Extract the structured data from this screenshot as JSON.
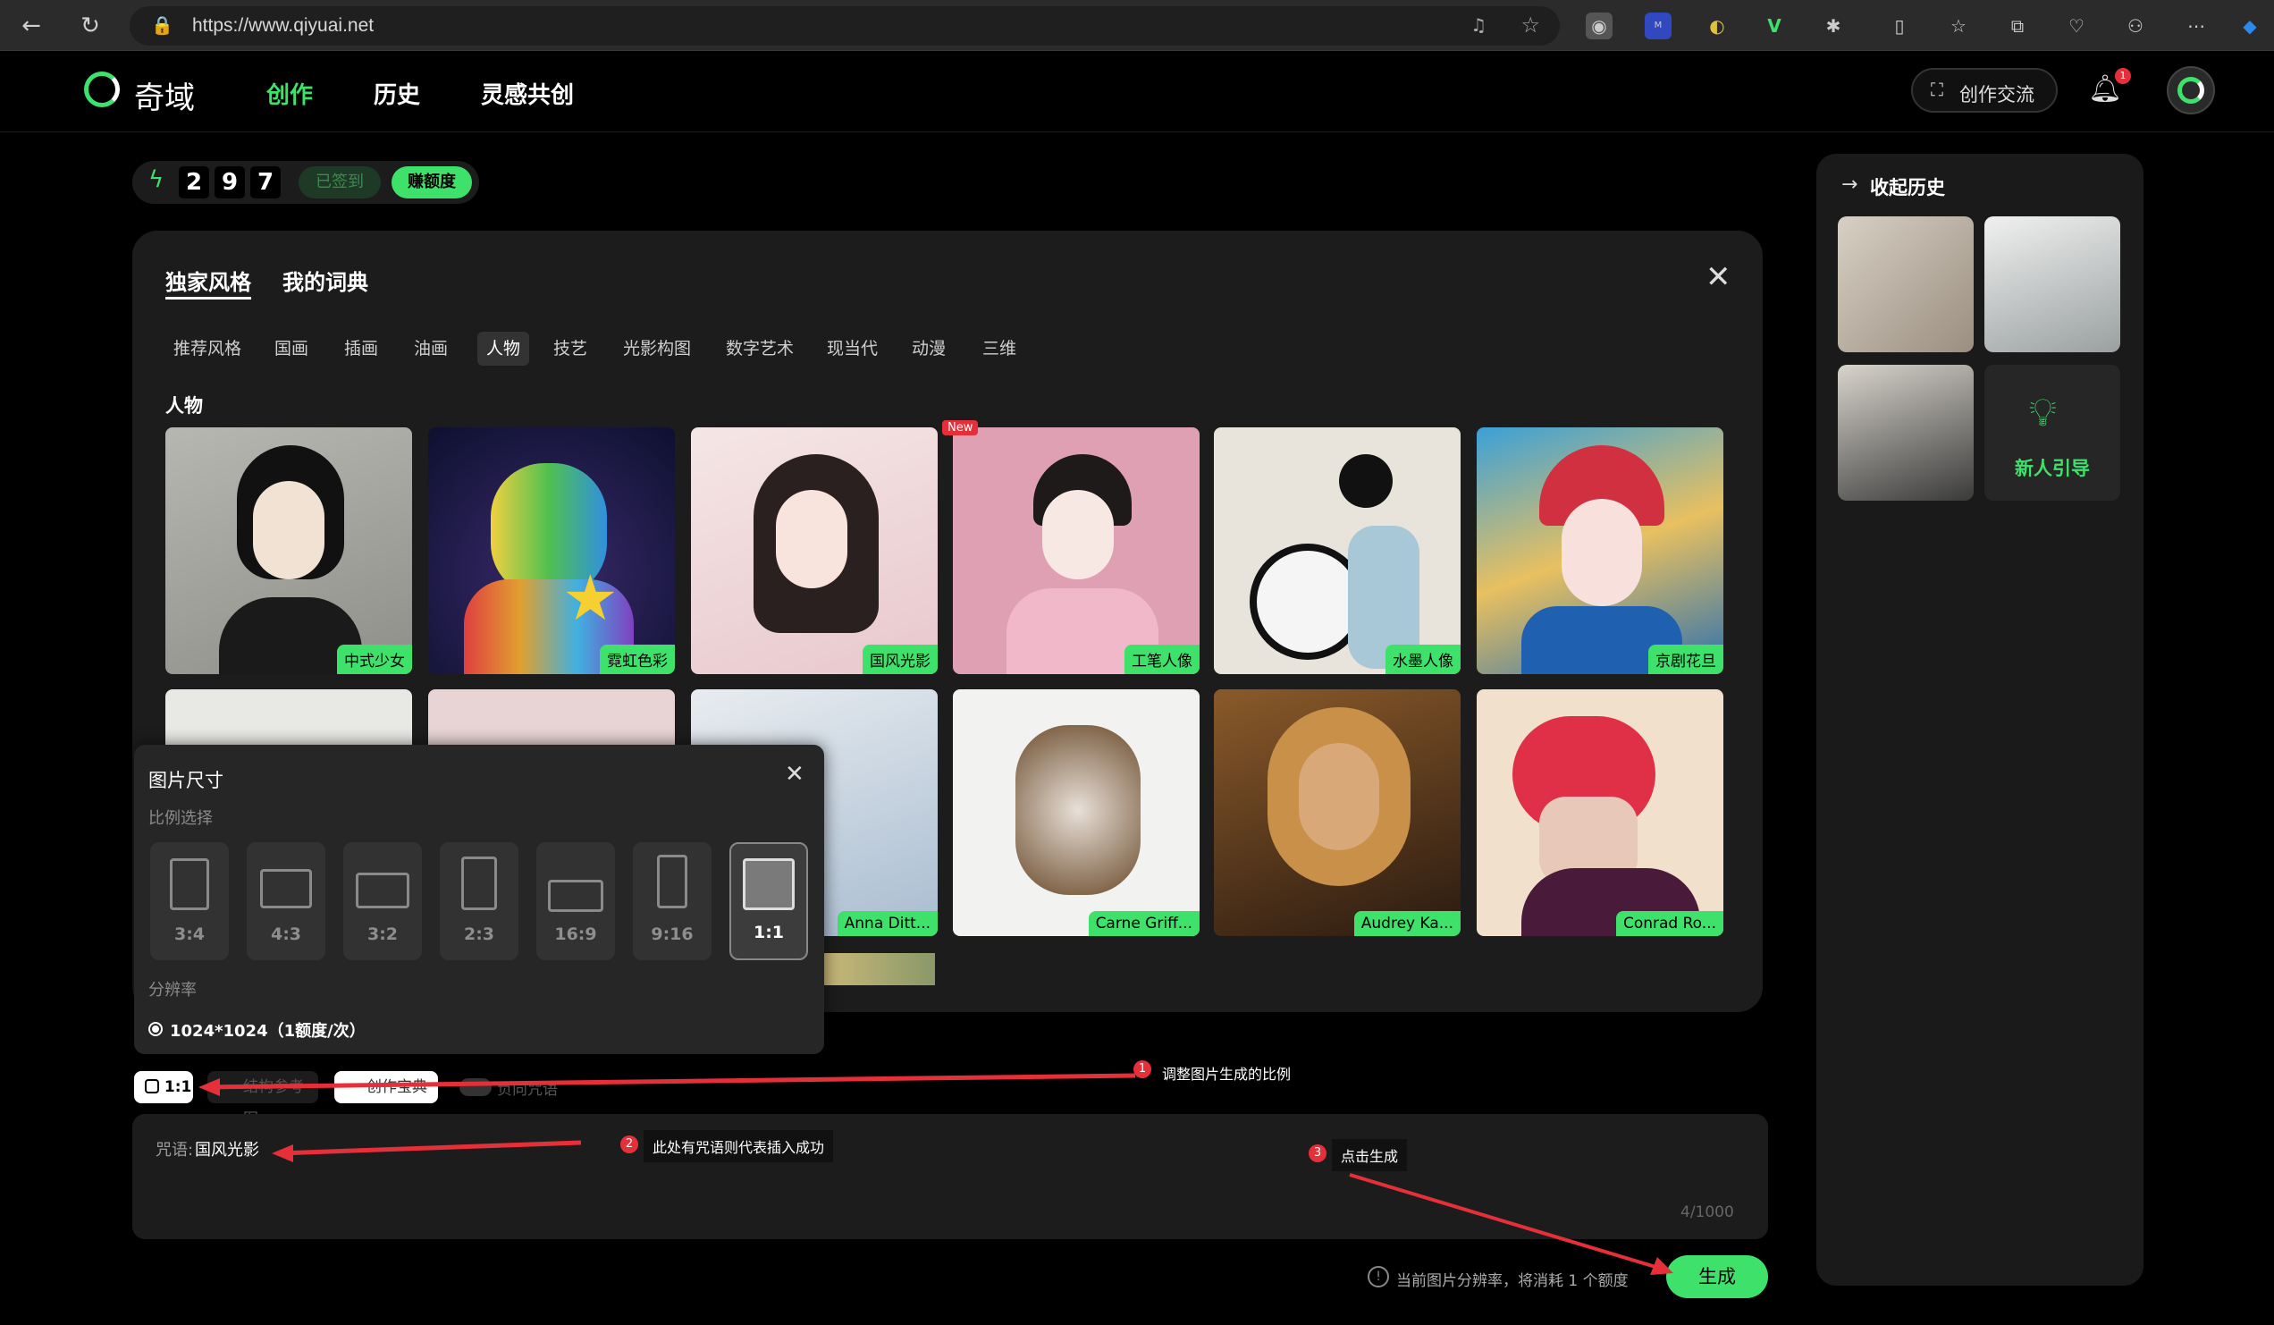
{
  "browser": {
    "url": "https://www.qiyuai.net",
    "icons": [
      "back-icon",
      "refresh-icon",
      "lock-icon",
      "read-aloud-icon",
      "favorite-icon"
    ]
  },
  "header": {
    "logo_text": "奇域",
    "nav": [
      "创作",
      "历史",
      "灵感共创"
    ],
    "exchange_button": "创作交流",
    "notification_count": "1"
  },
  "credits": {
    "digits": [
      "2",
      "9",
      "7"
    ],
    "checked_in": "已签到",
    "earn": "赚额度"
  },
  "panel": {
    "tabs": [
      "独家风格",
      "我的词典"
    ],
    "categories": [
      "推荐风格",
      "国画",
      "插画",
      "油画",
      "人物",
      "技艺",
      "光影构图",
      "数字艺术",
      "现当代",
      "动漫",
      "三维"
    ],
    "active_category": "人物",
    "section_title": "人物",
    "row1": [
      {
        "label": "中式少女",
        "badge": ""
      },
      {
        "label": "霓虹色彩",
        "badge": ""
      },
      {
        "label": "国风光影",
        "badge": ""
      },
      {
        "label": "工笔人像",
        "badge": "New"
      },
      {
        "label": "水墨人像",
        "badge": ""
      },
      {
        "label": "京剧花旦",
        "badge": ""
      }
    ],
    "row2": [
      {
        "label": ""
      },
      {
        "label": ""
      },
      {
        "label": "Anna Ditt..."
      },
      {
        "label": "Carne Griff..."
      },
      {
        "label": "Audrey Ka..."
      },
      {
        "label": "Conrad Ro..."
      }
    ]
  },
  "size_popup": {
    "title": "图片尺寸",
    "ratio_label": "比例选择",
    "ratios": [
      "3:4",
      "4:3",
      "3:2",
      "2:3",
      "16:9",
      "9:16",
      "1:1"
    ],
    "selected_ratio": "1:1",
    "resolution_label": "分辨率",
    "resolution_option": "1024*1024（1额度/次）"
  },
  "toolbar": {
    "ratio_button": "1:1",
    "struct_ref": "结构参考图",
    "treasure": "创作宝典",
    "negative": "负向咒语"
  },
  "prompt": {
    "label": "咒语:",
    "value": "国风光影",
    "counter": "4/1000"
  },
  "footer": {
    "info": "当前图片分辨率，将消耗 1 个额度",
    "generate": "生成"
  },
  "history": {
    "collapse": "收起历史",
    "guide": "新人引导"
  },
  "annotations": [
    {
      "num": "1",
      "text": "调整图片生成的比例"
    },
    {
      "num": "2",
      "text": "此处有咒语则代表插入成功"
    },
    {
      "num": "3",
      "text": "点击生成"
    }
  ],
  "colors": {
    "accent": "#3ee26a",
    "badge_red": "#e5303a"
  }
}
